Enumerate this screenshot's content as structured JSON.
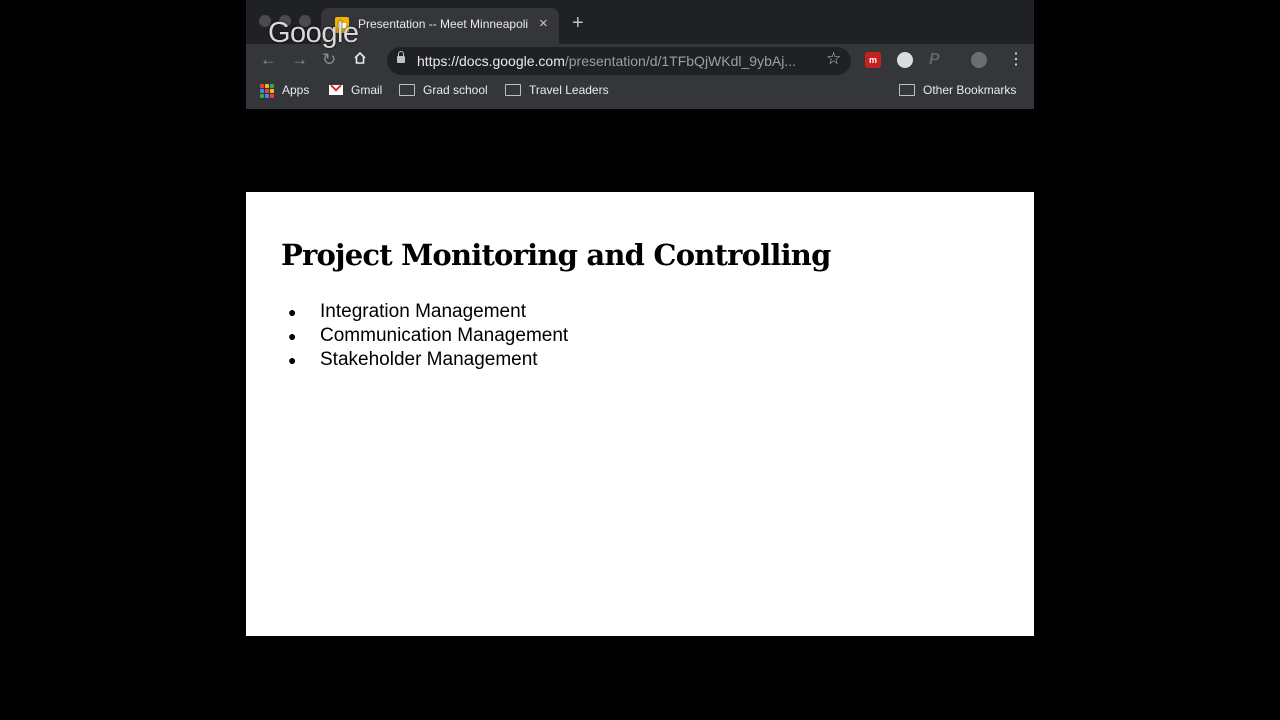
{
  "browser": {
    "tab_title": "Presentation -- Meet Minneapolis",
    "tab_close": "×",
    "new_tab": "+",
    "google_logo": "Google",
    "url_host": "https://docs.google.com",
    "url_path": "/presentation/d/1TFbQjWKdl_9ybAj...",
    "bookmarks": [
      {
        "label": "Apps",
        "icon": "apps-grid-icon"
      },
      {
        "label": "Gmail",
        "icon": "gmail-icon"
      },
      {
        "label": "Grad school",
        "icon": "folder-icon"
      },
      {
        "label": "Travel Leaders",
        "icon": "folder-icon"
      }
    ],
    "other_bookmarks": "Other Bookmarks"
  },
  "slide": {
    "title": "Project Monitoring and Controlling",
    "bullets": [
      "Integration Management",
      "Communication Management",
      "Stakeholder Management"
    ]
  },
  "colors": {
    "chrome_dark": "#202124",
    "chrome_toolbar": "#35363a",
    "slide_bg": "#ffffff",
    "background": "#000000"
  }
}
